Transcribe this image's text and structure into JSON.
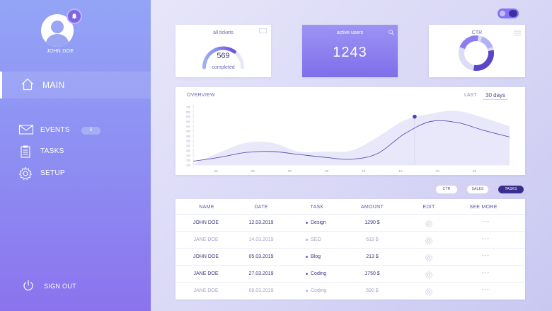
{
  "sidebar": {
    "user_name": "JOHN DOE",
    "main_label": "MAIN",
    "items": [
      {
        "label": "EVENTS",
        "badge": "5",
        "icon": "mail-icon"
      },
      {
        "label": "TASKS",
        "icon": "clipboard-icon"
      },
      {
        "label": "SETUP",
        "icon": "gear-icon"
      }
    ],
    "signout_label": "SIGN OUT"
  },
  "cards": {
    "tickets": {
      "title": "all tickets",
      "value": "569",
      "sub": "completed",
      "fraction": 0.7
    },
    "active": {
      "title": "active users",
      "value": "1243"
    },
    "ctr": {
      "title": "CTR"
    }
  },
  "overview": {
    "title": "OVERVIEW",
    "last_label": "LAST",
    "range": "30 days"
  },
  "filters": [
    "CTR",
    "SALES",
    "TASKS"
  ],
  "table": {
    "headers": [
      "NAME",
      "DATE",
      "TASK",
      "AMOUNT",
      "EDIT",
      "SEE MORE"
    ],
    "rows": [
      {
        "name": "JOHN DOE",
        "date": "12.03.2019",
        "task": "Design",
        "amount": "1290 $",
        "more": "---"
      },
      {
        "name": "JANE DOE",
        "date": "14.03.2019",
        "task": "SEO",
        "amount": "619 $",
        "more": "---"
      },
      {
        "name": "JOHN DOE",
        "date": "05.03.2019",
        "task": "Blog",
        "amount": "213 $",
        "more": "---"
      },
      {
        "name": "JANE DOE",
        "date": "27.03.2019",
        "task": "Coding",
        "amount": "1750 $",
        "more": "---"
      },
      {
        "name": "JANE DOE",
        "date": "09.03.2019",
        "task": "Coding",
        "amount": "590 $",
        "more": "---"
      }
    ]
  },
  "colors": {
    "accent": "#8574ef",
    "dark_accent": "#3b2d8e",
    "sidebar_top": "#93a4f6",
    "sidebar_bottom": "#8b73ee"
  },
  "chart_data": {
    "type": "line",
    "x": [
      15,
      17.5,
      20,
      22.5,
      25,
      27.5,
      30,
      32.5,
      35,
      37.5,
      40,
      42.5,
      45
    ],
    "xticks": [
      "20",
      "25",
      "30",
      "35",
      "10",
      "15",
      "20",
      "25"
    ],
    "yticks": [
      "700",
      "650",
      "600",
      "550",
      "500",
      "450",
      "400",
      "350",
      "300",
      "250",
      "200",
      "150",
      "100"
    ],
    "ylim": [
      100,
      700
    ],
    "series": [
      {
        "values": [
          110,
          230,
          330,
          330,
          240,
          240,
          250,
          390,
          560,
          630,
          660,
          590,
          500
        ]
      },
      {
        "values": [
          140,
          180,
          230,
          240,
          210,
          180,
          160,
          220,
          420,
          550,
          540,
          460,
          390
        ]
      }
    ],
    "highlight_point": {
      "x": 36,
      "y": 600
    }
  }
}
